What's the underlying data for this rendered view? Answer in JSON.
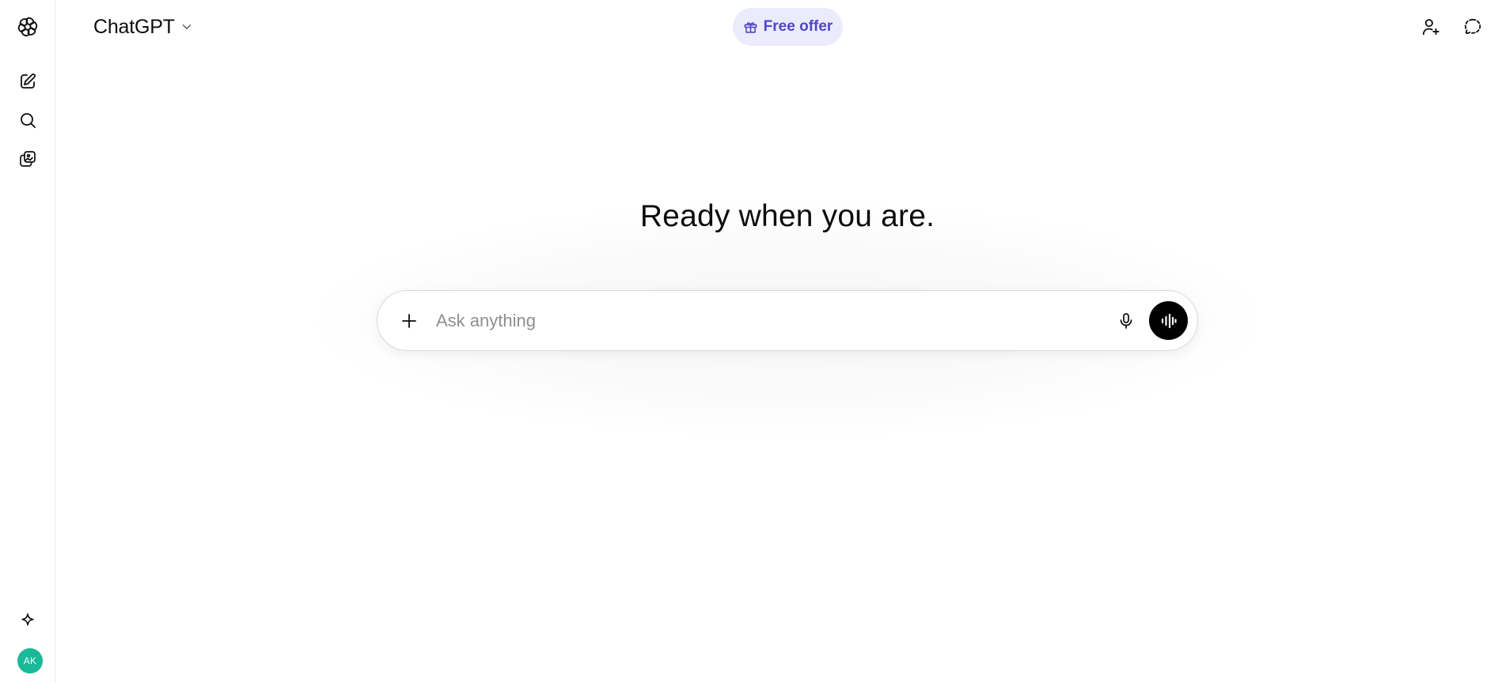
{
  "header": {
    "model_name": "ChatGPT",
    "free_offer_label": "Free offer"
  },
  "hero": {
    "title": "Ready when you are."
  },
  "composer": {
    "placeholder": "Ask anything",
    "value": ""
  },
  "sidebar": {
    "avatar_initials": "AK",
    "avatar_color": "#19b999",
    "items": [
      {
        "icon": "openai-logo-icon"
      },
      {
        "icon": "new-chat-icon"
      },
      {
        "icon": "search-icon"
      },
      {
        "icon": "library-icon"
      },
      {
        "icon": "sparkle-icon"
      }
    ]
  },
  "header_icons": [
    "add-user-icon",
    "temporary-chat-icon"
  ],
  "colors": {
    "free_offer_bg": "#ecebfb",
    "free_offer_text": "#4f46c8",
    "voice_button_bg": "#000000"
  }
}
